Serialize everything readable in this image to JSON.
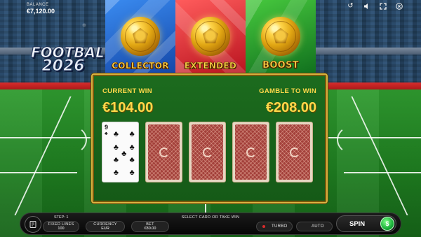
{
  "header": {
    "balance_label": "BALANCE",
    "balance_value": "€7,120.00"
  },
  "top_icons": [
    {
      "name": "history-icon",
      "glyph": "↺"
    },
    {
      "name": "sound-icon",
      "glyph": "🔈"
    },
    {
      "name": "fullscreen-icon",
      "glyph": "⛶"
    },
    {
      "name": "close-icon",
      "glyph": "✕"
    }
  ],
  "logo": {
    "line1": "FOOTBALL",
    "line2": "2026"
  },
  "features": [
    {
      "label": "COLLECTOR",
      "color": "#2a6fd6"
    },
    {
      "label": "EXTENDED",
      "color": "#e0323a"
    },
    {
      "label": "BOOST",
      "color": "#2aa83a"
    }
  ],
  "gamble": {
    "current_win_label": "CURRENT WIN",
    "current_win_value": "€104.00",
    "gamble_to_win_label": "GAMBLE TO WIN",
    "gamble_to_win_value": "€208.00",
    "revealed_card": {
      "rank": "9",
      "suit": "♣",
      "suit_name": "clubs"
    },
    "hidden_cards": 4
  },
  "bottom": {
    "step_label": "STEP: 1",
    "status_message": "SELECT CARD OR TAKE WIN",
    "fixed_lines_label": "FIXED LINES",
    "fixed_lines_value": "100",
    "currency_label": "CURRENCY",
    "currency_value": "EUR",
    "bet_label": "BET",
    "bet_value": "€80.00",
    "turbo_label": "TURBO",
    "auto_label": "AUTO",
    "spin_label": "SPIN",
    "take_win_icon": "$"
  },
  "colors": {
    "gold": "#ffd84a",
    "panel_green": "#1c6b1e",
    "card_back": "#a3403a",
    "toggle_dot": "#d92b2b"
  }
}
